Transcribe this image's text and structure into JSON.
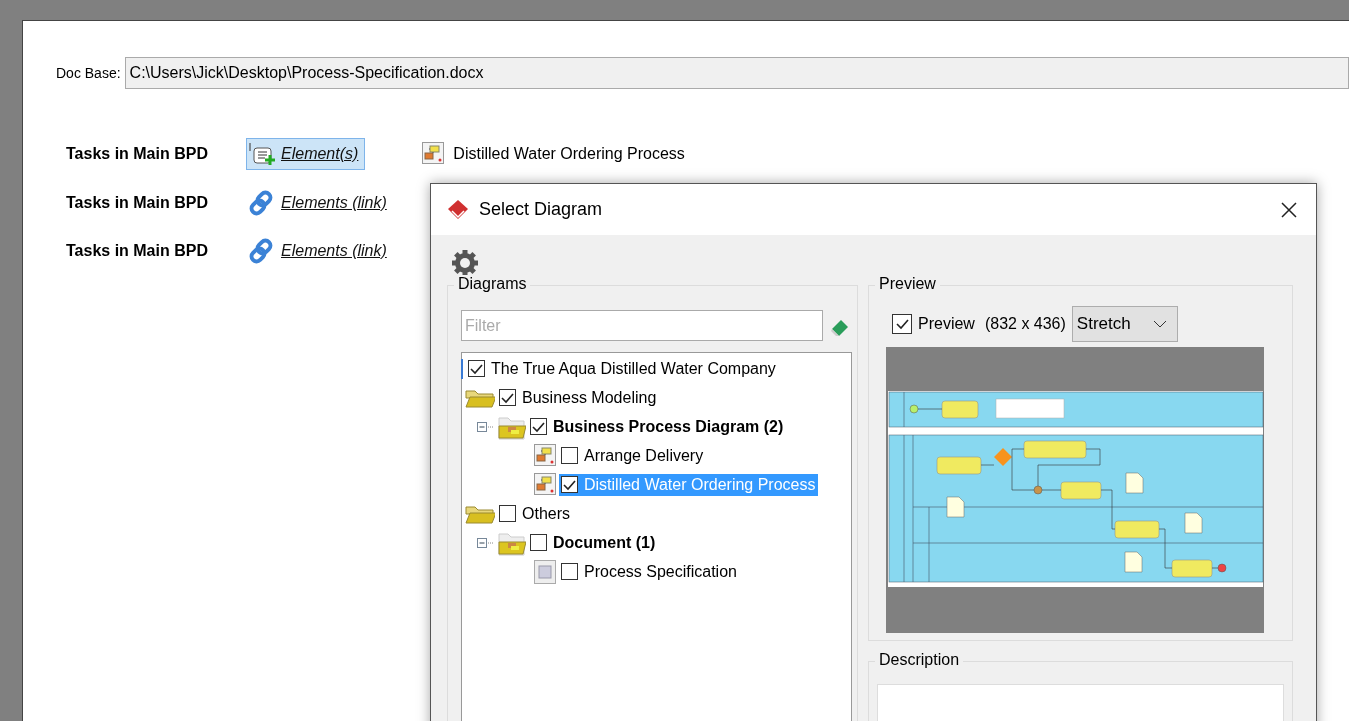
{
  "doc_base": {
    "label": "Doc Base:",
    "value": "C:\\Users\\Jick\\Desktop\\Process-Specification.docx"
  },
  "task_rows": [
    {
      "label": "Tasks in Main BPD",
      "kind": "element",
      "link": "Element(s)",
      "selected": true,
      "value": "Distilled Water Ordering Process"
    },
    {
      "label": "Tasks in Main BPD",
      "kind": "link",
      "link": "Elements (link)",
      "selected": false
    },
    {
      "label": "Tasks in Main BPD",
      "kind": "link",
      "link": "Elements (link)",
      "selected": false
    }
  ],
  "dialog": {
    "title": "Select Diagram",
    "diagrams": {
      "title": "Diagrams",
      "filter": {
        "placeholder": "Filter"
      },
      "tree": [
        {
          "label": "The True Aqua Distilled Water Company",
          "kind": "root",
          "checked": true,
          "selected": false,
          "children": [
            {
              "label": "Business Modeling",
              "kind": "folder",
              "checked": true,
              "selected": false,
              "children": [
                {
                  "label": "Business Process Diagram (2)",
                  "kind": "category",
                  "checked": true,
                  "selected": false,
                  "expanded": true,
                  "children": [
                    {
                      "label": "Arrange Delivery",
                      "kind": "diagram",
                      "checked": false,
                      "selected": false
                    },
                    {
                      "label": "Distilled Water Ordering Process",
                      "kind": "diagram",
                      "checked": true,
                      "selected": true
                    }
                  ]
                }
              ]
            },
            {
              "label": "Others",
              "kind": "folder",
              "checked": false,
              "selected": false,
              "children": [
                {
                  "label": "Document (1)",
                  "kind": "category",
                  "checked": false,
                  "selected": false,
                  "expanded": true,
                  "children": [
                    {
                      "label": "Process Specification",
                      "kind": "document",
                      "checked": false,
                      "selected": false
                    }
                  ]
                }
              ]
            }
          ]
        }
      ]
    },
    "preview": {
      "title": "Preview",
      "checkbox": {
        "label": "Preview",
        "checked": true
      },
      "size": "(832 x 436)",
      "mode": "Stretch"
    },
    "description": {
      "title": "Description"
    }
  }
}
